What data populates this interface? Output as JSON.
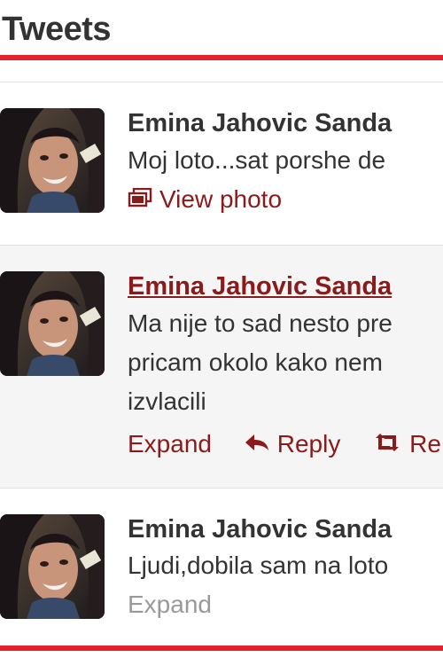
{
  "header": {
    "title": "Tweets"
  },
  "colors": {
    "accent_red": "#e4222e",
    "link_dark_red": "#8b1a1a",
    "text": "#333333",
    "muted": "#999999"
  },
  "tweets": [
    {
      "name": "Emina Jahovic Sanda",
      "text_lines": [
        "Moj loto...sat porshe de"
      ],
      "actions": [
        {
          "label": "View photo",
          "icon": "photo-icon"
        }
      ]
    },
    {
      "name": "Emina Jahovic Sanda",
      "text_lines": [
        "Ma nije to sad nesto pre",
        "pricam okolo kako nem",
        "izvlacili"
      ],
      "actions": [
        {
          "label": "Expand",
          "icon": ""
        },
        {
          "label": "Reply",
          "icon": "reply-icon"
        },
        {
          "label": "Re",
          "icon": "retweet-icon"
        }
      ]
    },
    {
      "name": "Emina Jahovic Sanda",
      "text_lines": [
        "Ljudi,dobila sam na loto"
      ],
      "actions": [
        {
          "label": "Expand",
          "icon": ""
        }
      ]
    }
  ]
}
